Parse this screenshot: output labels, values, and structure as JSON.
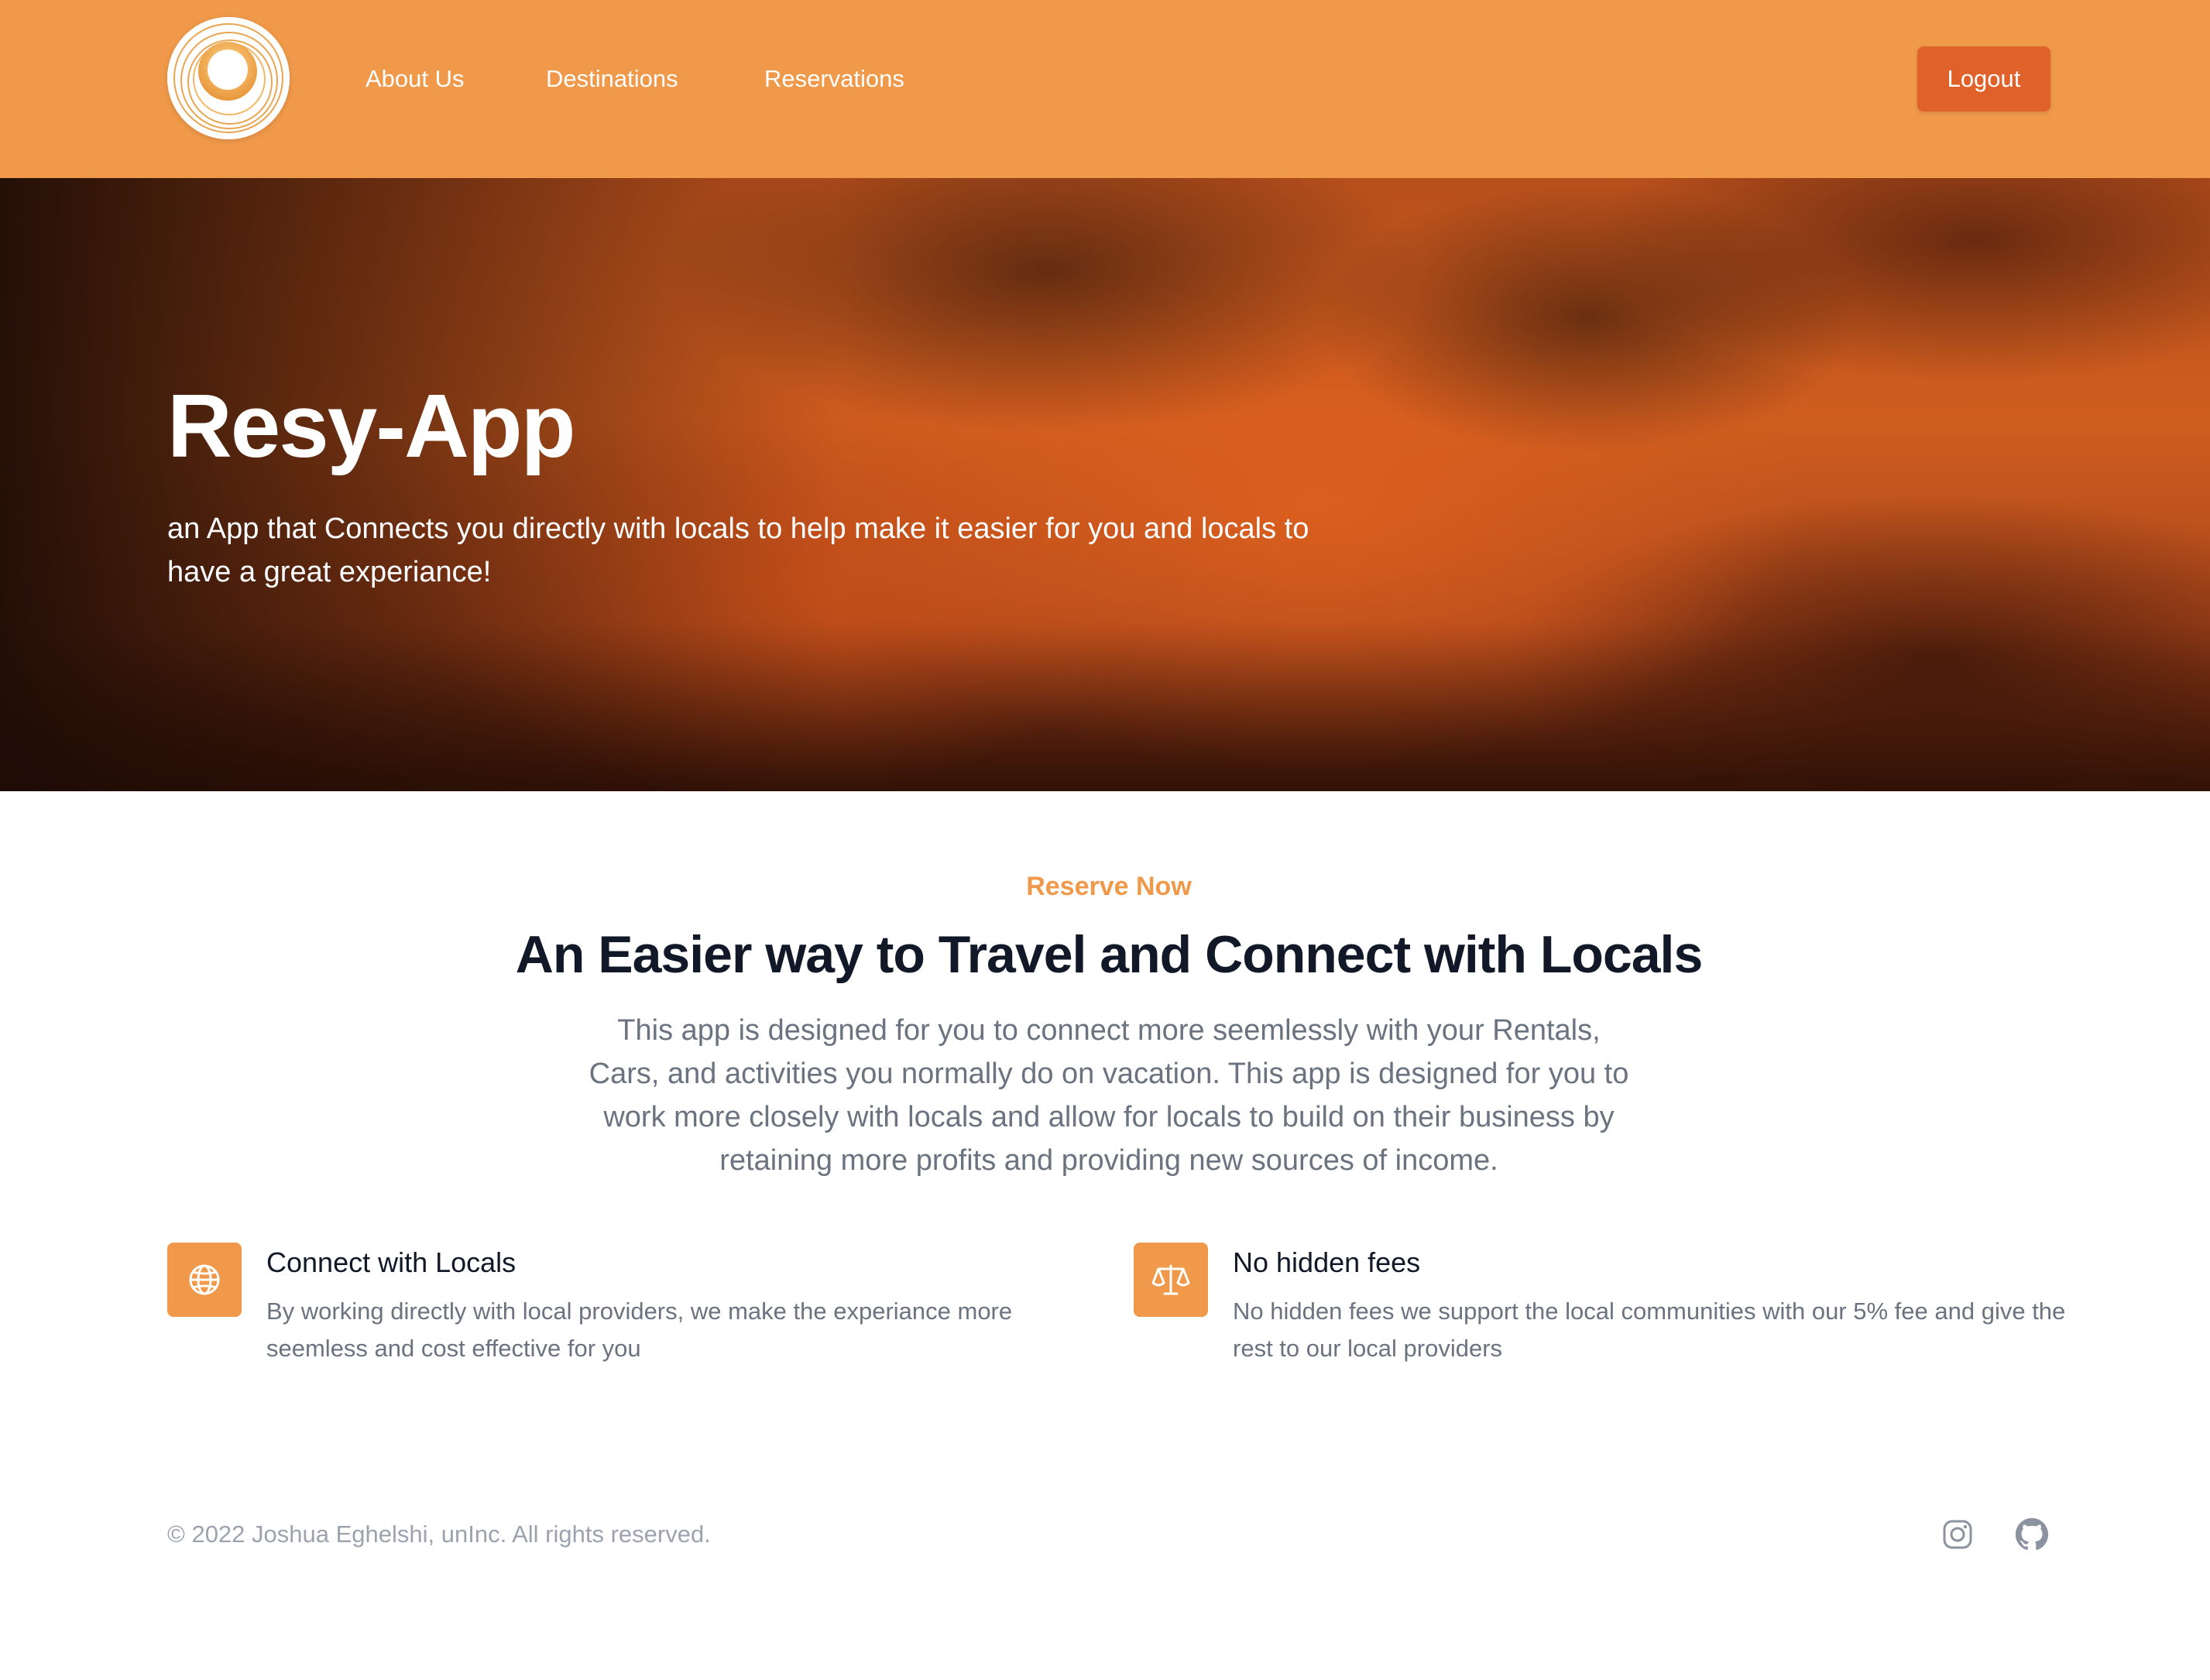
{
  "header": {
    "nav": [
      {
        "label": "About Us"
      },
      {
        "label": "Destinations"
      },
      {
        "label": "Reservations"
      }
    ],
    "logout_label": "Logout"
  },
  "hero": {
    "title": "Resy-App",
    "subtitle": "an App that Connects you directly with locals to help make it easier for you and locals to have a great experiance!"
  },
  "features_section": {
    "eyebrow": "Reserve Now",
    "title": "An Easier way to Travel and Connect with Locals",
    "description": "This app is designed for you to connect more seemlessly with your Rentals, Cars, and activities you normally do on vacation. This app is designed for you to work more closely with locals and allow for locals to build on their business by retaining more profits and providing new sources of income.",
    "features": [
      {
        "icon": "globe-icon",
        "title": "Connect with Locals",
        "description": "By working directly with local providers, we make the experiance more seemless and cost effective for you"
      },
      {
        "icon": "scale-icon",
        "title": "No hidden fees",
        "description": "No hidden fees we support the local communities with our 5% fee and give the rest to our local providers"
      }
    ]
  },
  "footer": {
    "copyright": "© 2022 Joshua Eghelshi, unInc. All rights reserved.",
    "social": [
      {
        "icon": "instagram-icon"
      },
      {
        "icon": "github-icon"
      }
    ]
  },
  "colors": {
    "header_bg": "#f0994a",
    "logout_bg": "#e0622a",
    "accent": "#f0994a",
    "heading": "#111827",
    "body_text": "#6b7280",
    "footer_text": "#9ca3af"
  }
}
